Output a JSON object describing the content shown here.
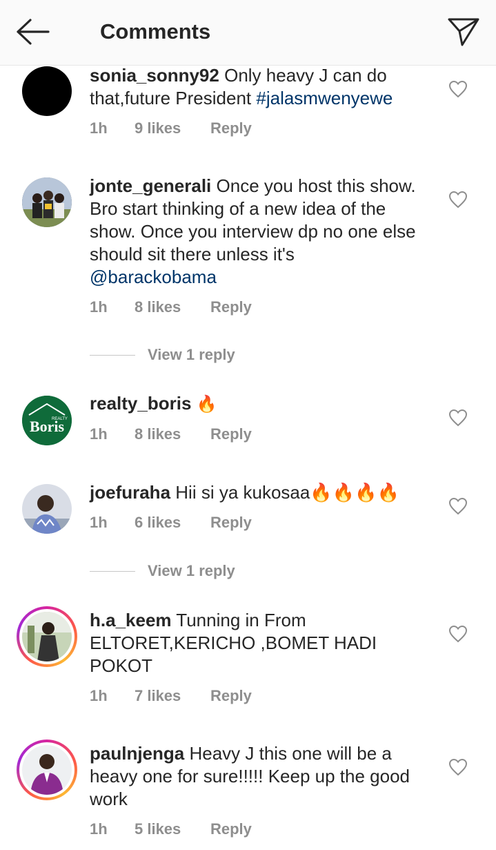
{
  "header": {
    "title": "Comments",
    "back_icon": "arrow-left-icon",
    "share_icon": "paper-plane-icon"
  },
  "comments": [
    {
      "username": "sonia_sonny92",
      "text": "Only heavy J can do that,future President ",
      "hashtag": "#jalasmwenyewe",
      "time": "1h",
      "likes": "9 likes",
      "reply": "Reply"
    },
    {
      "username": "jonte_generali",
      "text": "Once you host this show. Bro start thinking of a new idea of the show. Once you interview dp no one else should sit there unless it's ",
      "mention": "@barackobama",
      "time": "1h",
      "likes": "8 likes",
      "reply": "Reply",
      "view_replies": "View 1 reply"
    },
    {
      "username": "realty_boris",
      "text": "🔥",
      "time": "1h",
      "likes": "8 likes",
      "reply": "Reply",
      "avatar_logo_top": "REALTY",
      "avatar_logo": "Boris"
    },
    {
      "username": "joefuraha",
      "text": "Hii si ya kukosaa🔥🔥🔥🔥",
      "time": "1h",
      "likes": "6 likes",
      "reply": "Reply",
      "view_replies": "View 1 reply"
    },
    {
      "username": "h.a_keem",
      "text": "Tunning in From ELTORET,KERICHO ,BOMET HADI POKOT",
      "time": "1h",
      "likes": "7 likes",
      "reply": "Reply"
    },
    {
      "username": "paulnjenga",
      "text": "Heavy J this one will be a heavy one for sure!!!!! Keep up the good work",
      "time": "1h",
      "likes": "5 likes",
      "reply": "Reply"
    }
  ],
  "colors": {
    "link": "#003569",
    "meta": "#8e8e8e",
    "text": "#262626",
    "header_bg": "#fafafa"
  }
}
